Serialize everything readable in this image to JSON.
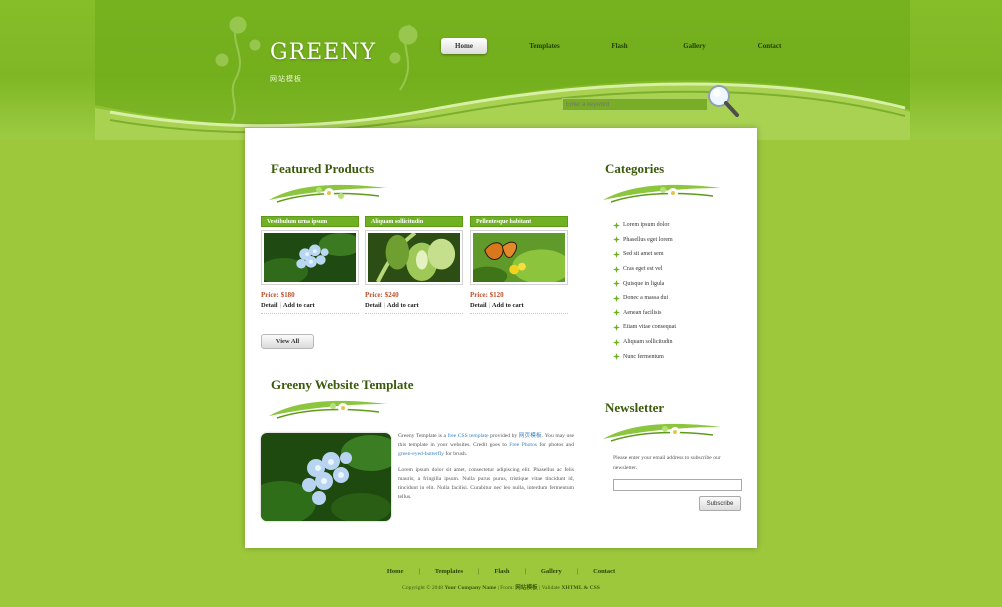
{
  "brand": {
    "title": "GREENY",
    "subtitle": "网站模板"
  },
  "nav": [
    "Home",
    "Templates",
    "Flash",
    "Gallery",
    "Contact"
  ],
  "search": {
    "placeholder": "Enter a keyword"
  },
  "featured": {
    "title": "Featured Products",
    "products": [
      {
        "name": "Vestibulum urna ipsum",
        "price": "Price: $180",
        "detail": "Detail",
        "cart": "Add to cart",
        "image": "blue-flowers"
      },
      {
        "name": "Aliquam sollicitudin",
        "price": "Price: $240",
        "detail": "Detail",
        "cart": "Add to cart",
        "image": "green-plant"
      },
      {
        "name": "Pellentesque habitant",
        "price": "Price: $120",
        "detail": "Detail",
        "cart": "Add to cart",
        "image": "butterfly"
      }
    ],
    "view_all": "View All"
  },
  "categories": {
    "title": "Categories",
    "items": [
      "Lorem ipsum dolor",
      "Phasellus eget lorem",
      "Sed sit amet sem",
      "Cras eget est vel",
      "Quisque in ligula",
      "Donec a massa dui",
      "Aenean facilisis",
      "Etiam vitae consequat",
      "Aliquam sollicitudin",
      "Nunc fermentum"
    ]
  },
  "about": {
    "title": "Greeny Website Template",
    "p1": {
      "t1": "Greeny Template is a ",
      "l1": "free CSS template",
      "t2": " provided by ",
      "l2": "网页模板",
      "t3": ". You may use this template in your websites. Credit goes to ",
      "l3": "Free Photos",
      "t4": " for photos and ",
      "l4": "green-eyed-butterfly",
      "t5": " for brush."
    },
    "p2": "Lorem ipsum dolor sit amet, consectetur adipiscing elit. Phasellus ac felis mauris, a fringilla ipsum. Nulla purus purus, tristique vitae tincidunt id, tincidunt in elit. Nulla facilisi. Curabitur nec leo nulla, interdum fermentum tellus."
  },
  "newsletter": {
    "title": "Newsletter",
    "text": "Please enter your email address to subscribe our newsletter.",
    "button": "Subscribe"
  },
  "footer": {
    "links": [
      "Home",
      "Templates",
      "Flash",
      "Gallery",
      "Contact"
    ],
    "copyright": {
      "prefix": "Copyright © 2048 ",
      "company": "Your Company Name",
      "mid1": " | From: ",
      "from": "网站模板",
      "mid2": " | Validate ",
      "validate": "XHTML & CSS"
    }
  },
  "colors": {
    "background": "#9dc83c",
    "header": "#7fb824",
    "title_green": "#3b5a0b",
    "price": "#c0502a",
    "link": "#3a7fbf"
  }
}
